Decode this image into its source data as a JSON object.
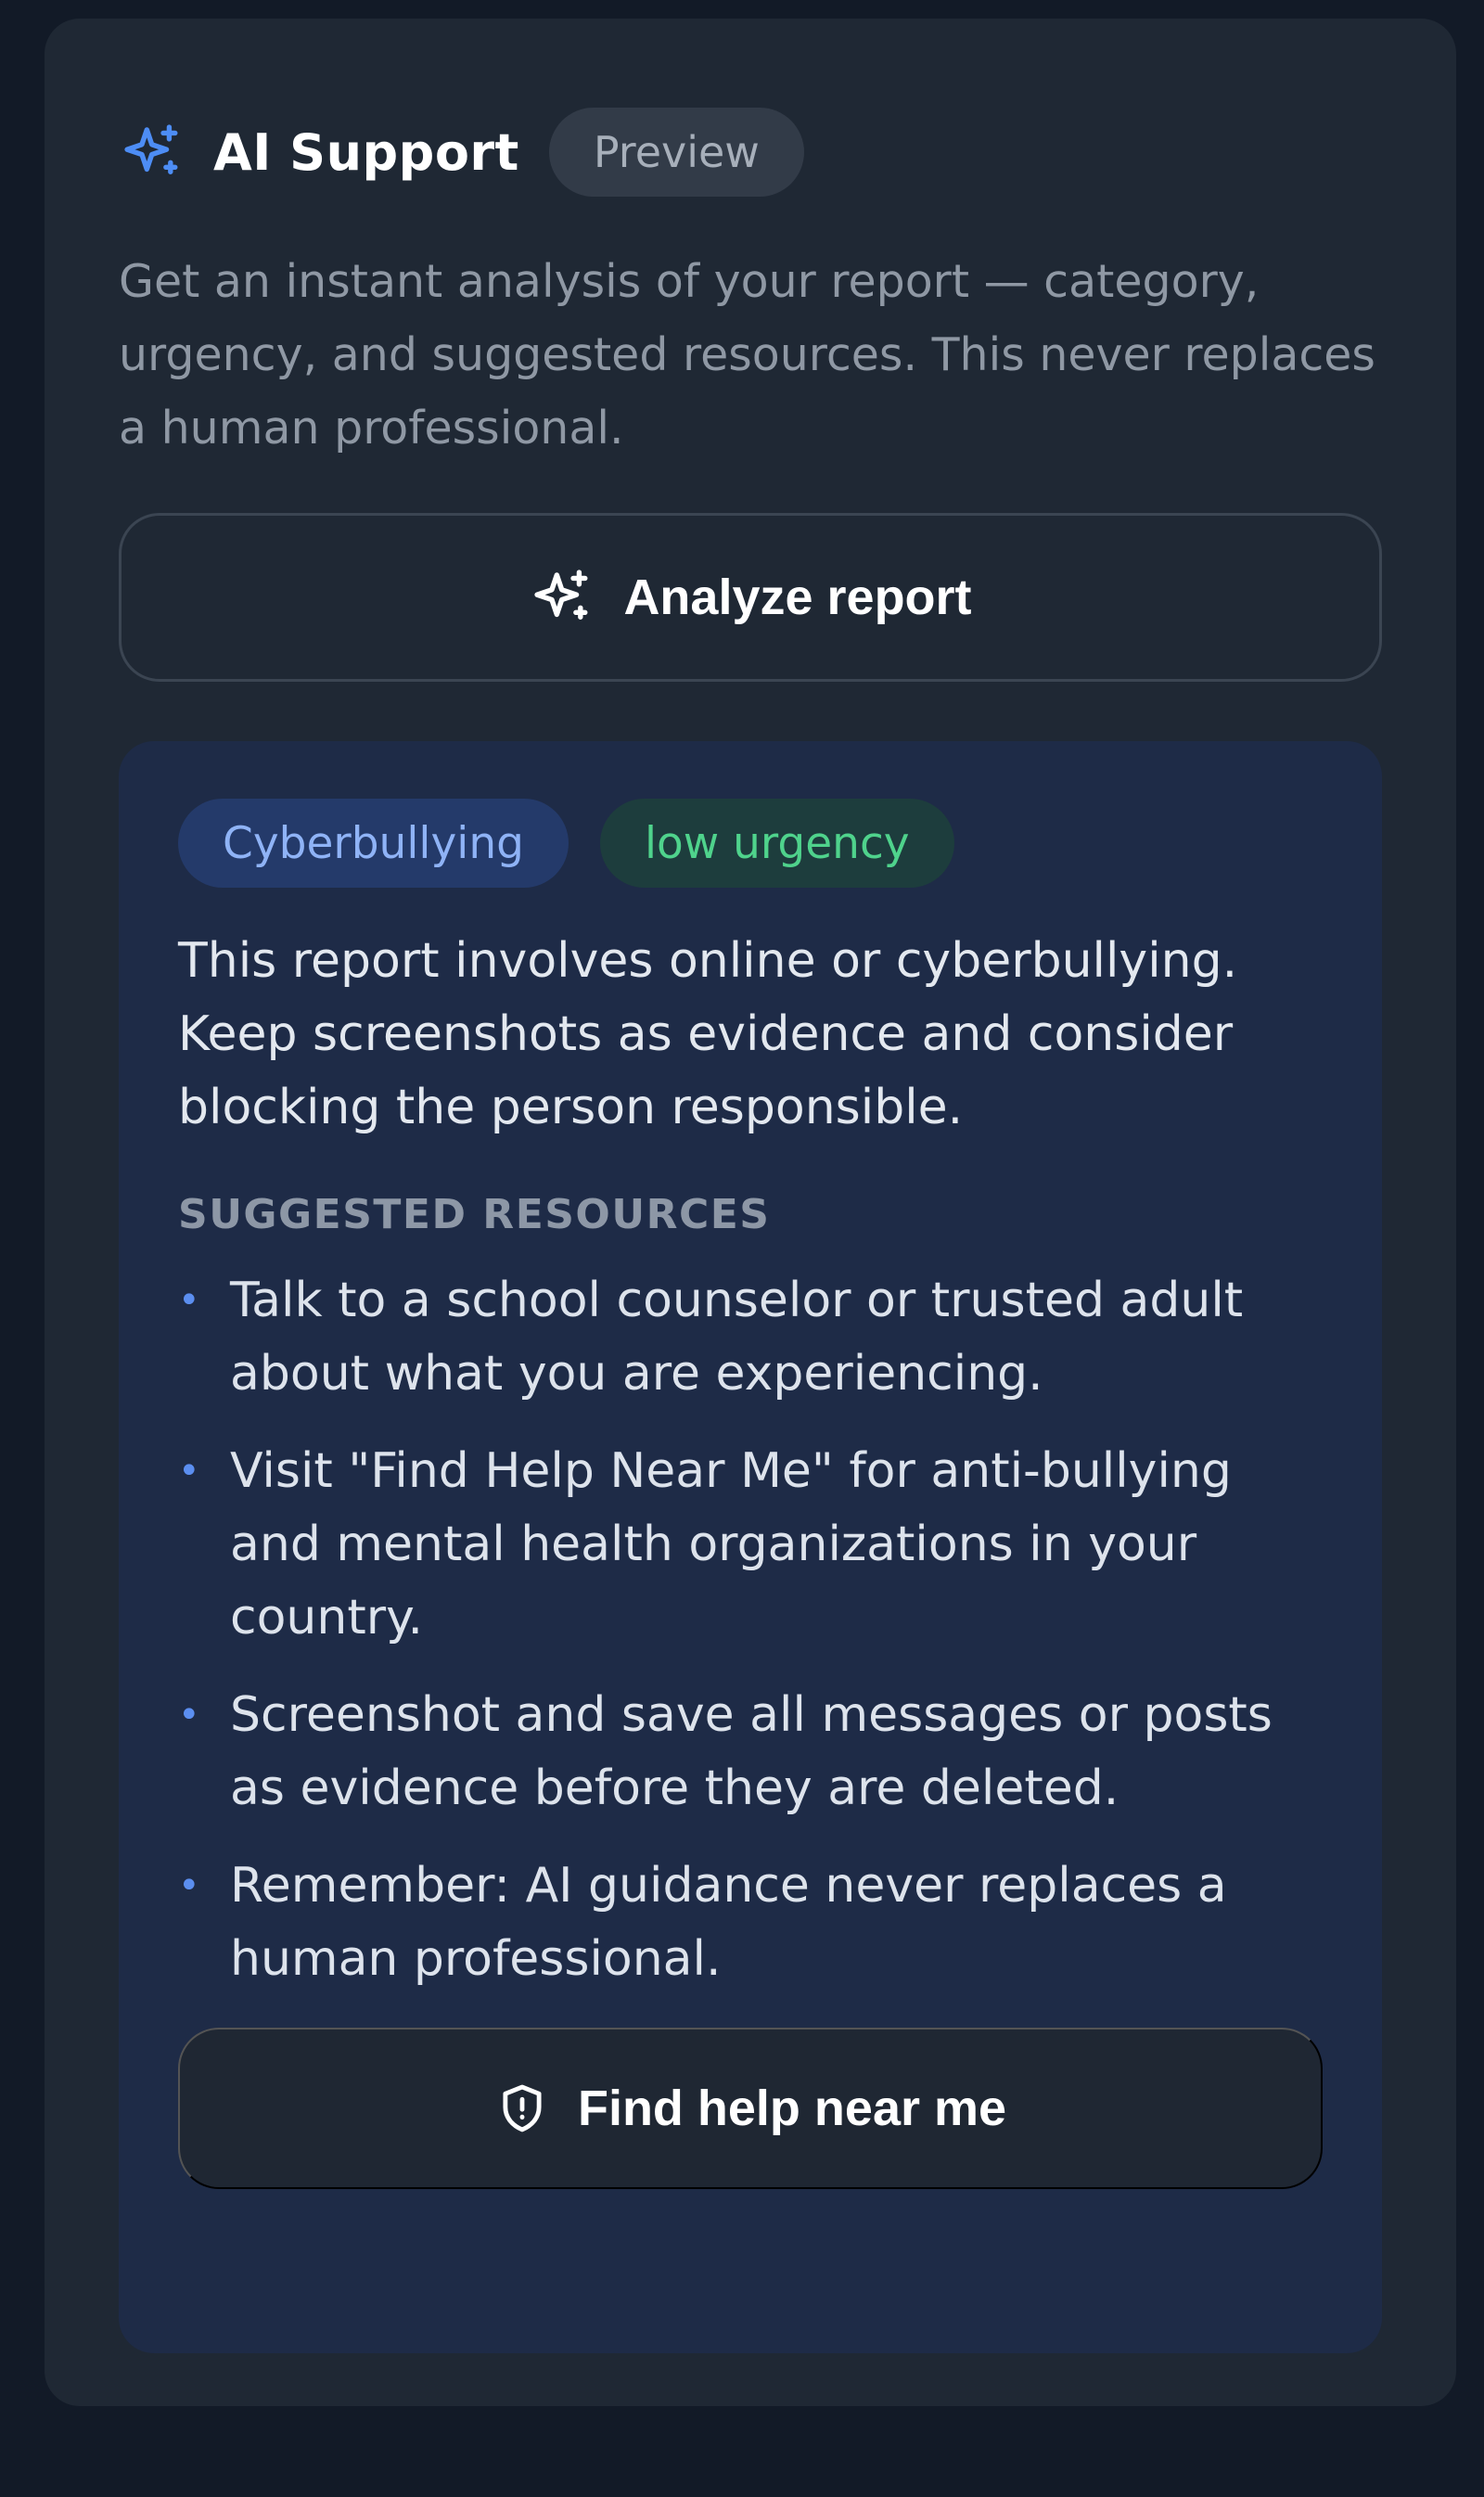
{
  "header": {
    "title": "AI Support",
    "badge": "Preview",
    "icon": "sparkle-icon",
    "icon_color": "#4d8df5"
  },
  "description": "Get an instant analysis of your report — category, urgency, and suggested resources. This never replaces a human professional.",
  "analyze_button": {
    "label": "Analyze report",
    "icon": "sparkle-icon"
  },
  "result": {
    "tags": {
      "category": "Cyberbullying",
      "urgency": "low urgency"
    },
    "summary": "This report involves online or cyberbullying. Keep screenshots as evidence and consider blocking the person responsible.",
    "resources_heading": "SUGGESTED RESOURCES",
    "resources": [
      "Talk to a school counselor or trusted adult about what you are experiencing.",
      "Visit \"Find Help Near Me\" for anti-bullying and mental health organizations in your country.",
      "Screenshot and save all messages or posts as evidence before they are deleted.",
      "Remember: AI guidance never replaces a human professional."
    ],
    "help_button": {
      "label": "Find help near me",
      "icon": "shield-alert-icon"
    }
  },
  "colors": {
    "page_bg": "#121a27",
    "card_bg": "#1f2834",
    "result_bg": "#1e2b47",
    "accent": "#4d8df5",
    "urgency_low": "#4fd38c"
  }
}
